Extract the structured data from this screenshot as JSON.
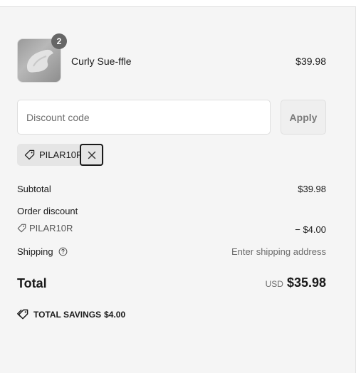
{
  "cart": {
    "items": [
      {
        "quantity": "2",
        "name": "Curly Sue-ffle",
        "price": "$39.98"
      }
    ]
  },
  "discount": {
    "placeholder": "Discount code",
    "apply_label": "Apply",
    "applied_code": "PILAR10R"
  },
  "summary": {
    "subtotal_label": "Subtotal",
    "subtotal_value": "$39.98",
    "order_discount_label": "Order discount",
    "discount_code": "PILAR10R",
    "discount_amount": "− $4.00",
    "shipping_label": "Shipping",
    "shipping_value": "Enter shipping address",
    "total_label": "Total",
    "currency": "USD",
    "total_value": "$35.98",
    "savings_label": "TOTAL SAVINGS",
    "savings_value": "$4.00"
  },
  "icons": {
    "tag": "tag-icon",
    "remove": "close-icon",
    "help": "help-circle-icon",
    "savings": "double-tag-icon"
  }
}
